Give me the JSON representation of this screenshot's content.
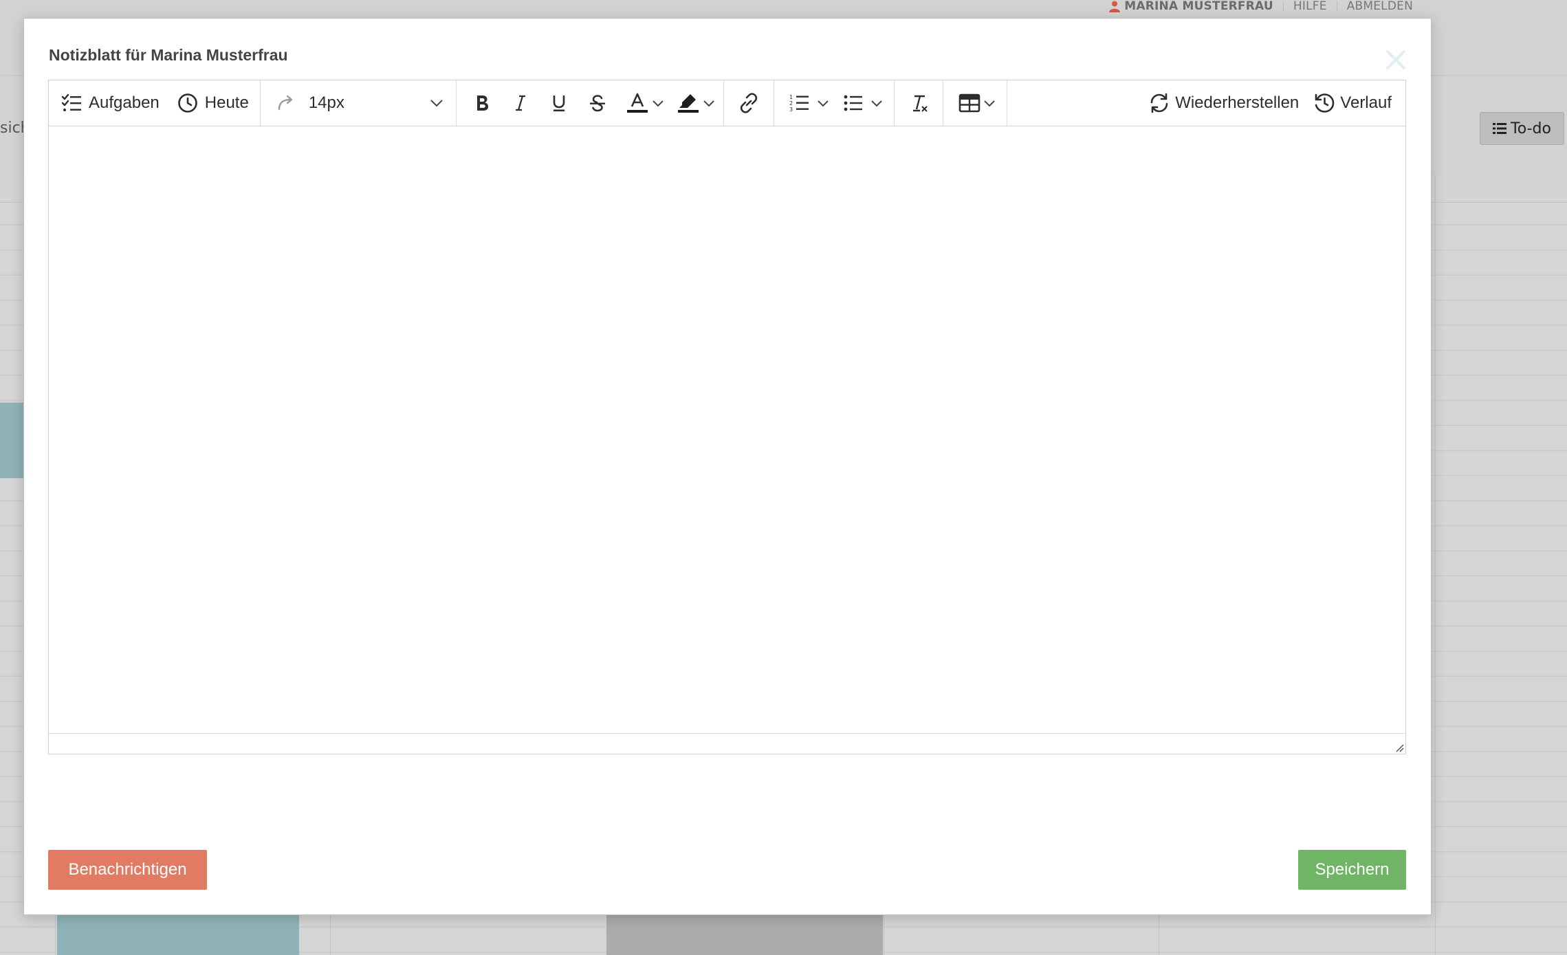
{
  "header": {
    "user_name": "MARINA MUSTERFRAU",
    "help": "HILFE",
    "logout": "ABMELDEN"
  },
  "background": {
    "left_label": "sich",
    "todo_button": "To-do"
  },
  "modal": {
    "title": "Notizblatt für Marina Musterfrau",
    "toolbar": {
      "tasks_label": "Aufgaben",
      "today_label": "Heute",
      "font_size": "14px",
      "restore_label": "Wiederherstellen",
      "history_label": "Verlauf"
    },
    "content": "",
    "notify_button": "Benachrichtigen",
    "save_button": "Speichern"
  },
  "colors": {
    "notify": "#e27b63",
    "save": "#6fb565",
    "user_icon": "#d9573a",
    "event_teal": "#8fb3b6"
  },
  "icons": [
    "user-icon",
    "list-icon",
    "tasklist-icon",
    "clock-icon",
    "redo-icon",
    "bold-icon",
    "italic-icon",
    "underline-icon",
    "strikethrough-icon",
    "text-color-icon",
    "highlight-icon",
    "link-icon",
    "ordered-list-icon",
    "bullet-list-icon",
    "clear-format-icon",
    "table-icon",
    "restore-icon",
    "history-icon",
    "close-icon",
    "resize-handle-icon",
    "chevron-down-icon"
  ]
}
